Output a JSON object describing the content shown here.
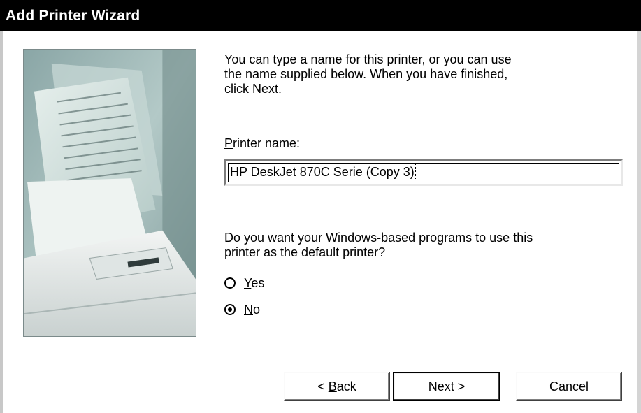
{
  "window": {
    "title": "Add Printer Wizard"
  },
  "intro_text": "You can type a name for this printer, or you can use\nthe name supplied below. When you have finished,\nclick Next.",
  "printer_name": {
    "label_mnemonic": "P",
    "label_rest": "rinter name:",
    "value": "HP DeskJet 870C Serie (Copy 3)"
  },
  "default_question": "Do you want your Windows-based programs to use this\nprinter as the default printer?",
  "default_options": [
    {
      "mnemonic": "Y",
      "rest": "es",
      "checked": false
    },
    {
      "mnemonic": "N",
      "rest": "o",
      "checked": true
    }
  ],
  "buttons": {
    "back_prefix": "< ",
    "back_mnemonic": "B",
    "back_rest": "ack",
    "next": "Next >",
    "cancel": "Cancel"
  },
  "illustration": {
    "icon": "printer-with-paper-illustration",
    "tint": "#a9c3c1"
  }
}
